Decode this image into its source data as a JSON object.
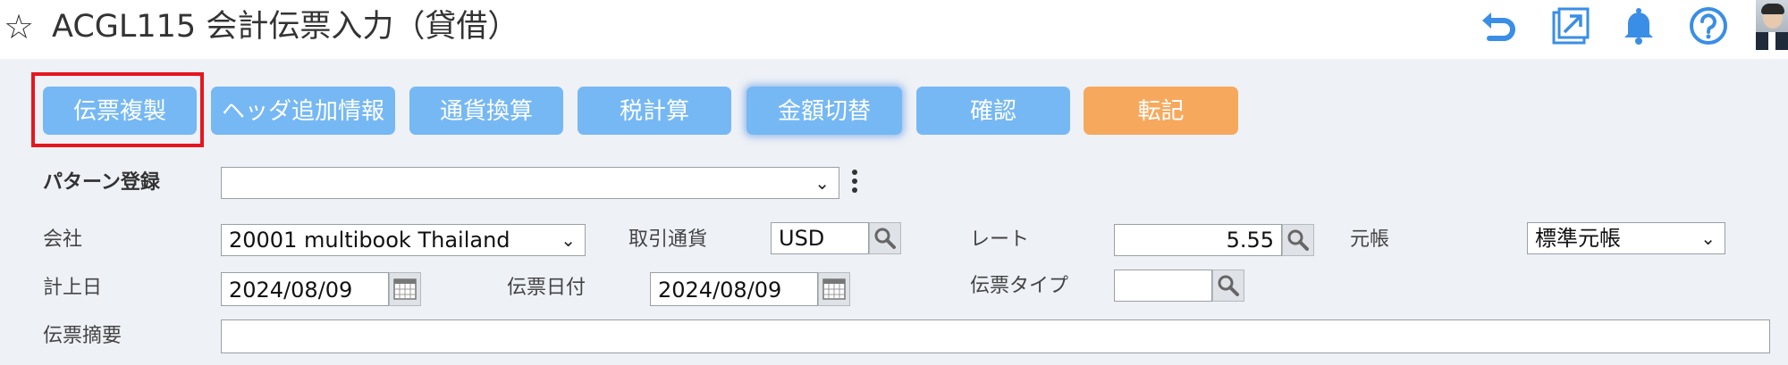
{
  "header": {
    "title": "ACGL115 会計伝票入力（貸借）",
    "icons": [
      "star-icon",
      "undo-icon",
      "export-icon",
      "bell-icon",
      "help-icon",
      "avatar"
    ]
  },
  "toolbar": {
    "buttons": [
      {
        "label": "伝票複製"
      },
      {
        "label": "ヘッダ追加情報"
      },
      {
        "label": "通貨換算"
      },
      {
        "label": "税計算"
      },
      {
        "label": "金額切替"
      },
      {
        "label": "確認"
      },
      {
        "label": "転記"
      }
    ]
  },
  "form": {
    "pattern_label": "パターン登録",
    "pattern_value": "",
    "company_label": "会社",
    "company_value": "20001 multibook Thailand",
    "currency_label": "取引通貨",
    "currency_value": "USD",
    "rate_label": "レート",
    "rate_value": "5.55",
    "ledger_label": "元帳",
    "ledger_value": "標準元帳",
    "posting_date_label": "計上日",
    "posting_date_value": "2024/08/09",
    "voucher_date_label": "伝票日付",
    "voucher_date_value": "2024/08/09",
    "voucher_type_label": "伝票タイプ",
    "voucher_type_value": "",
    "summary_label": "伝票摘要",
    "summary_value": ""
  },
  "colors": {
    "button_blue": "#76b8f4",
    "button_orange": "#f6a95d",
    "highlight_red": "#e5171f",
    "icon_blue": "#3a8ee6",
    "background": "#eef1f6"
  }
}
